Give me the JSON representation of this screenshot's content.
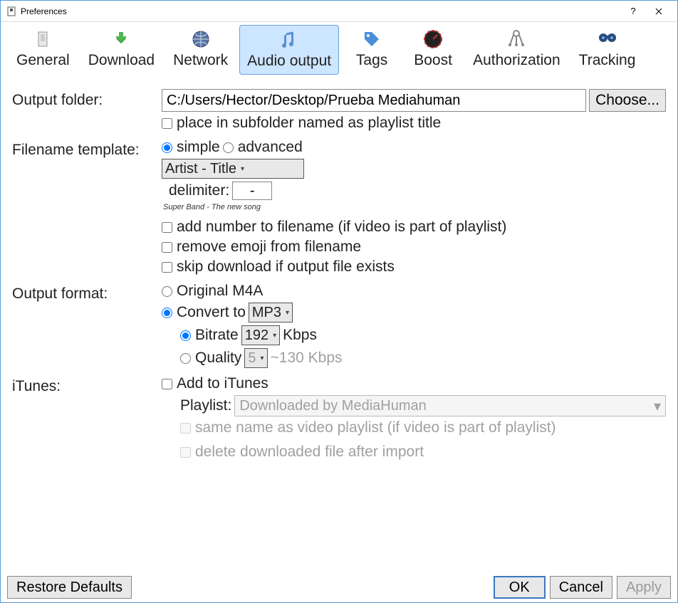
{
  "window": {
    "title": "Preferences"
  },
  "tabs": {
    "general": "General",
    "download": "Download",
    "network": "Network",
    "audio_output": "Audio output",
    "tags": "Tags",
    "boost": "Boost",
    "authorization": "Authorization",
    "tracking": "Tracking"
  },
  "labels": {
    "output_folder": "Output folder:",
    "filename_template": "Filename template:",
    "output_format": "Output format:",
    "itunes": "iTunes:",
    "delimiter": "delimiter:",
    "playlist": "Playlist:"
  },
  "values": {
    "output_path": "C:/Users/Hector/Desktop/Prueba Mediahuman",
    "choose": "Choose...",
    "subfolder": "place in subfolder named as playlist title",
    "simple": "simple",
    "advanced": "advanced",
    "template_select": "Artist - Title",
    "delimiter_val": "-",
    "example": "Super Band - The new song",
    "add_number": "add number to filename (if video is part of playlist)",
    "remove_emoji": "remove emoji from filename",
    "skip_download": "skip download if output file exists",
    "original_m4a": "Original M4A",
    "convert_to": "Convert to",
    "mp3": "MP3",
    "bitrate": "Bitrate",
    "bitrate_val": "192",
    "kbps": "Kbps",
    "quality": "Quality",
    "quality_val": "5",
    "quality_est": "~130 Kbps",
    "add_itunes": "Add to iTunes",
    "playlist_val": "Downloaded by MediaHuman",
    "same_name": "same name as video playlist (if video is part of playlist)",
    "delete_after": "delete downloaded file after import"
  },
  "footer": {
    "restore": "Restore Defaults",
    "ok": "OK",
    "cancel": "Cancel",
    "apply": "Apply"
  }
}
